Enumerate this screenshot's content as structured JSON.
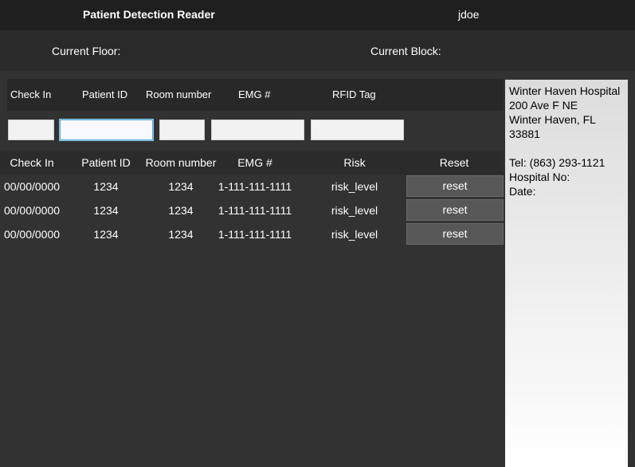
{
  "header": {
    "title": "Patient Detection Reader",
    "user": "jdoe"
  },
  "location": {
    "floor_label": "Current Floor:",
    "block_label": "Current Block:"
  },
  "filter": {
    "columns": [
      "Check In",
      "Patient ID",
      "Room number",
      "EMG #",
      "RFID Tag"
    ],
    "values": [
      "",
      "",
      "",
      "",
      ""
    ]
  },
  "table": {
    "columns": [
      "Check In",
      "Patient ID",
      "Room number",
      "EMG #",
      "Risk",
      "Reset"
    ],
    "rows": [
      {
        "check_in": "00/00/0000",
        "patient_id": "1234",
        "room": "1234",
        "emg": "1-111-111-1111",
        "risk": "risk_level",
        "reset": "reset"
      },
      {
        "check_in": "00/00/0000",
        "patient_id": "1234",
        "room": "1234",
        "emg": "1-111-111-1111",
        "risk": "risk_level",
        "reset": "reset"
      },
      {
        "check_in": "00/00/0000",
        "patient_id": "1234",
        "room": "1234",
        "emg": "1-111-111-1111",
        "risk": "risk_level",
        "reset": "reset"
      }
    ]
  },
  "hospital": {
    "name": "Winter Haven Hospital",
    "street": "200 Ave F NE",
    "city": "Winter Haven, FL 33881",
    "tel": "Tel: (863) 293-1121",
    "hospital_no": "Hospital No:",
    "date": "Date:"
  }
}
